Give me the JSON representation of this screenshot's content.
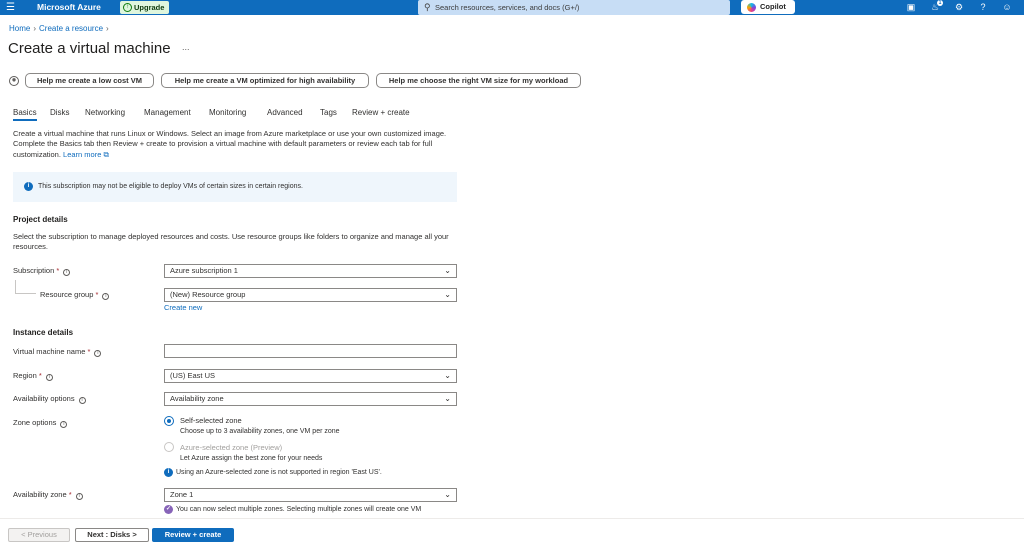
{
  "topbar": {
    "brand": "Microsoft Azure",
    "upgrade_label": "Upgrade",
    "search_placeholder": "Search resources, services, and docs (G+/)",
    "copilot_label": "Copilot",
    "notification_count": "1",
    "icons": [
      "menu-icon",
      "cloud-shell-icon",
      "bell-icon",
      "gear-icon",
      "help-icon",
      "feedback-icon"
    ]
  },
  "breadcrumb": {
    "home": "Home",
    "create_resource": "Create a resource"
  },
  "page_title": "Create a virtual machine",
  "more_label": "...",
  "help_buttons": [
    "Help me create a low cost VM",
    "Help me create a VM optimized for high availability",
    "Help me choose the right VM size for my workload"
  ],
  "tabs": [
    "Basics",
    "Disks",
    "Networking",
    "Management",
    "Monitoring",
    "Advanced",
    "Tags",
    "Review + create"
  ],
  "intro": {
    "text": "Create a virtual machine that runs Linux or Windows. Select an image from Azure marketplace or use your own customized image. Complete the Basics tab then Review + create to provision a virtual machine with default parameters or review each tab for full customization.",
    "learn_more": "Learn more"
  },
  "info_banner": "This subscription may not be eligible to deploy VMs of certain sizes in certain regions.",
  "project_details": {
    "heading": "Project details",
    "description": "Select the subscription to manage deployed resources and costs. Use resource groups like folders to organize and manage all your resources.",
    "subscription_label": "Subscription",
    "subscription_value": "Azure subscription 1",
    "resource_group_label": "Resource group",
    "resource_group_value": "(New) Resource group",
    "create_new": "Create new"
  },
  "instance_details": {
    "heading": "Instance details",
    "vm_name_label": "Virtual machine name",
    "vm_name_value": "",
    "region_label": "Region",
    "region_value": "(US) East US",
    "availability_options_label": "Availability options",
    "availability_options_value": "Availability zone",
    "zone_options_label": "Zone options",
    "zone_self_title": "Self-selected zone",
    "zone_self_sub": "Choose up to 3 availability zones, one VM per zone",
    "zone_azure_title": "Azure-selected zone (Preview)",
    "zone_azure_sub": "Let Azure assign the best zone for your needs",
    "zone_note": "Using an Azure-selected zone is not supported in region 'East US'.",
    "availability_zone_label": "Availability zone",
    "availability_zone_value": "Zone 1",
    "multi_zone_note": "You can now select multiple zones. Selecting multiple zones will create one VM"
  },
  "footer": {
    "previous": "< Previous",
    "next": "Next : Disks >",
    "review": "Review + create"
  }
}
